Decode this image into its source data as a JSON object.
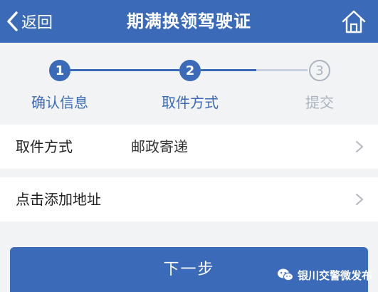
{
  "header": {
    "back_label": "返回",
    "title": "期满换领驾驶证",
    "back_icon": "chevron-left-icon",
    "home_icon": "home-icon"
  },
  "stepper": {
    "current_step": 2,
    "steps": [
      {
        "number": "1",
        "label": "确认信息",
        "status": "done"
      },
      {
        "number": "2",
        "label": "取件方式",
        "status": "active"
      },
      {
        "number": "3",
        "label": "提交",
        "status": "pending"
      }
    ]
  },
  "form": {
    "pickup_method": {
      "label": "取件方式",
      "value": "邮政寄递"
    },
    "add_address": {
      "label": "点击添加地址"
    }
  },
  "actions": {
    "next_label": "下一步"
  },
  "watermark": {
    "text": "银川交警微发布",
    "icon": "wechat-icon"
  },
  "colors": {
    "primary": "#3a6ab8",
    "pending_step": "#aab3bf",
    "pending_line": "#c6d0de",
    "background": "#f2f3f5"
  }
}
